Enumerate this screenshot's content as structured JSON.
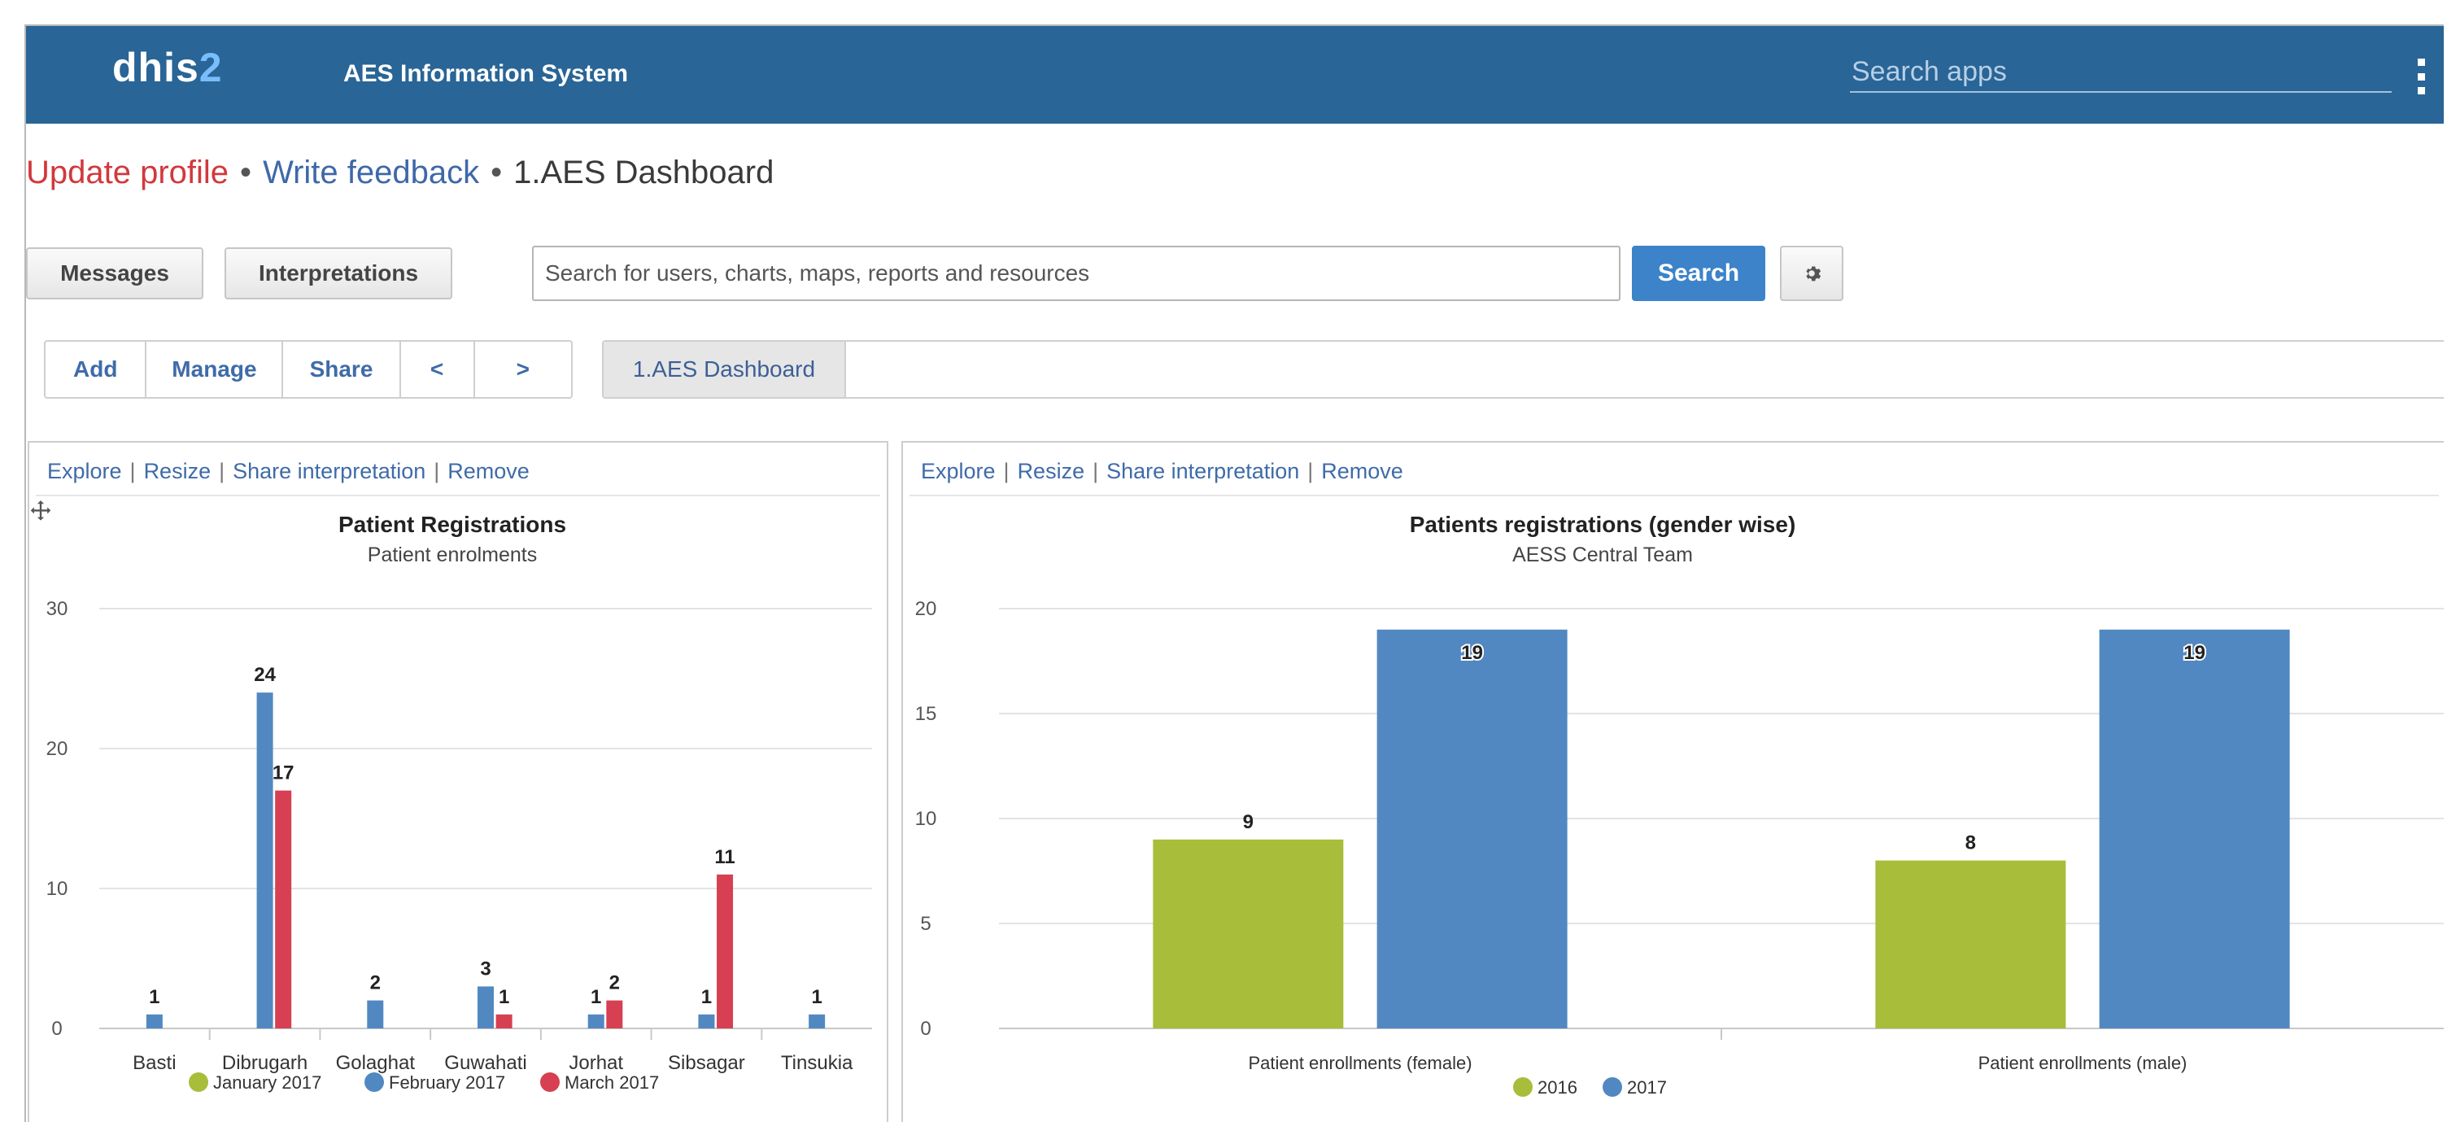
{
  "header": {
    "logo_main": "dhis",
    "logo_num": "2",
    "app_title": "AES Information System",
    "search_placeholder": "Search apps"
  },
  "breadcrumb": {
    "update_profile": "Update profile",
    "write_feedback": "Write feedback",
    "current": "1.AES Dashboard",
    "separator": "•"
  },
  "toolbar": {
    "messages": "Messages",
    "interpretations": "Interpretations",
    "search_placeholder": "Search for users, charts, maps, reports and resources",
    "search_button": "Search"
  },
  "dashboard_bar": {
    "add": "Add",
    "manage": "Manage",
    "share": "Share",
    "prev": "<",
    "next": ">",
    "active_tab": "1.AES Dashboard"
  },
  "panel_links": {
    "explore": "Explore",
    "resize": "Resize",
    "share_interpretation": "Share interpretation",
    "remove": "Remove",
    "separator": "|"
  },
  "colors": {
    "topbar": "#296596",
    "green": "#a8bd3a",
    "blue": "#5288c1",
    "red": "#d64052",
    "link": "#3f6ba9"
  },
  "chart_data": [
    {
      "type": "bar",
      "title": "Patient Registrations",
      "subtitle": "Patient enrolments",
      "categories": [
        "Basti",
        "Dibrugarh",
        "Golaghat",
        "Guwahati",
        "Jorhat",
        "Sibsagar",
        "Tinsukia"
      ],
      "series": [
        {
          "name": "January 2017",
          "color": "#a8bd3a",
          "values": [
            null,
            null,
            null,
            null,
            null,
            null,
            null
          ]
        },
        {
          "name": "February 2017",
          "color": "#5288c1",
          "values": [
            1,
            24,
            2,
            3,
            1,
            1,
            1
          ]
        },
        {
          "name": "March 2017",
          "color": "#d64052",
          "values": [
            null,
            17,
            null,
            1,
            2,
            11,
            null
          ]
        }
      ],
      "yticks": [
        0,
        10,
        20,
        30
      ],
      "ylim": [
        0,
        30
      ],
      "grid": true,
      "legend": "bottom-center"
    },
    {
      "type": "bar",
      "title": "Patients registrations (gender wise)",
      "subtitle": "AESS Central Team",
      "categories": [
        "Patient enrollments (female)",
        "Patient enrollments (male)"
      ],
      "series": [
        {
          "name": "2016",
          "color": "#a8bd3a",
          "values": [
            9,
            8
          ]
        },
        {
          "name": "2017",
          "color": "#5288c1",
          "values": [
            19,
            19
          ]
        }
      ],
      "yticks": [
        0,
        5,
        10,
        15,
        20
      ],
      "ylim": [
        0,
        20
      ],
      "grid": true,
      "legend": "bottom-center"
    }
  ]
}
